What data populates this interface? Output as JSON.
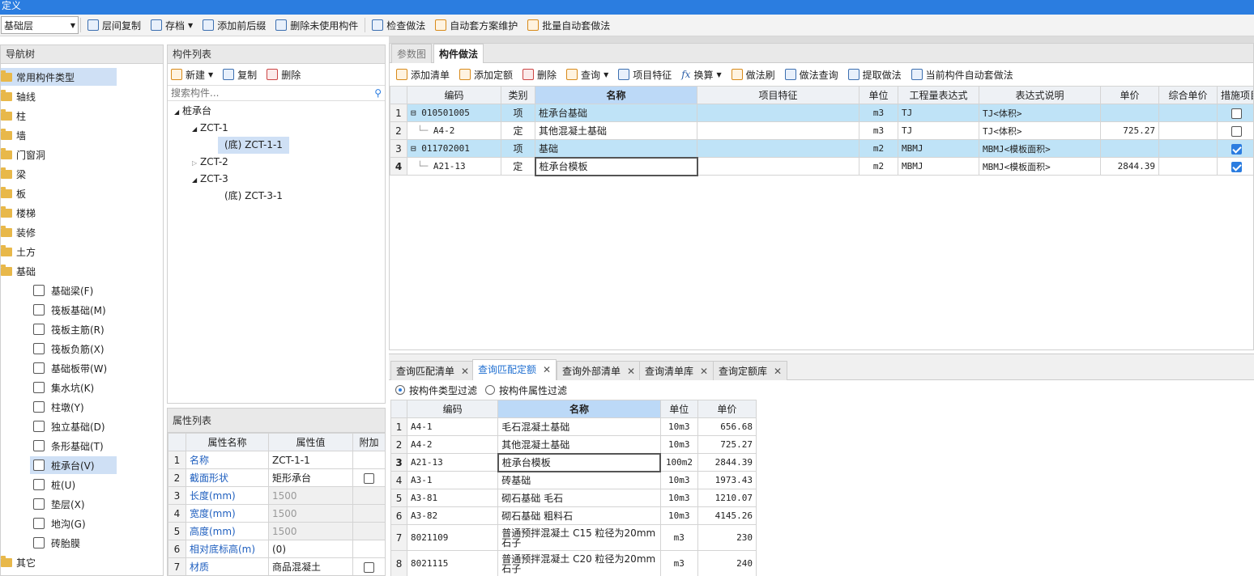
{
  "window": {
    "title": "定义"
  },
  "toolbar": {
    "layer": "基础层",
    "buttons": [
      "层间复制",
      "存档",
      "添加前后缀",
      "删除未使用构件",
      "检查做法",
      "自动套方案维护",
      "批量自动套做法"
    ]
  },
  "nav": {
    "title": "导航树",
    "items": [
      "常用构件类型",
      "轴线",
      "柱",
      "墙",
      "门窗洞",
      "梁",
      "板",
      "楼梯",
      "装修",
      "土方",
      "基础"
    ],
    "foundation_children": [
      "基础梁(F)",
      "筏板基础(M)",
      "筏板主筋(R)",
      "筏板负筋(X)",
      "基础板带(W)",
      "集水坑(K)",
      "柱墩(Y)",
      "独立基础(D)",
      "条形基础(T)",
      "桩承台(V)",
      "桩(U)",
      "垫层(X)",
      "地沟(G)",
      "砖胎膜"
    ],
    "other": "其它"
  },
  "component_list": {
    "title": "构件列表",
    "new_label": "新建",
    "copy_label": "复制",
    "delete_label": "删除",
    "search_placeholder": "搜索构件...",
    "tree": {
      "root": "桩承台",
      "n1": "ZCT-1",
      "n1a": "(底) ZCT-1-1",
      "n2": "ZCT-2",
      "n3": "ZCT-3",
      "n3a": "(底) ZCT-3-1"
    }
  },
  "properties": {
    "title": "属性列表",
    "headers": [
      "属性名称",
      "属性值",
      "附加"
    ],
    "rows": [
      {
        "no": "1",
        "name": "名称",
        "value": "ZCT-1-1"
      },
      {
        "no": "2",
        "name": "截面形状",
        "value": "矩形承台"
      },
      {
        "no": "3",
        "name": "长度(mm)",
        "value": "1500"
      },
      {
        "no": "4",
        "name": "宽度(mm)",
        "value": "1500"
      },
      {
        "no": "5",
        "name": "高度(mm)",
        "value": "1500"
      },
      {
        "no": "6",
        "name": "相对底标高(m)",
        "value": "(0)"
      },
      {
        "no": "7",
        "name": "材质",
        "value": "商品混凝土"
      }
    ]
  },
  "method": {
    "tabs": [
      "参数图",
      "构件做法"
    ],
    "toolbar": [
      "添加清单",
      "添加定额",
      "删除",
      "查询",
      "项目特征",
      "换算",
      "做法刷",
      "做法查询",
      "提取做法",
      "当前构件自动套做法"
    ],
    "headers": [
      "编码",
      "类别",
      "名称",
      "项目特征",
      "单位",
      "工程量表达式",
      "表达式说明",
      "单价",
      "综合单价",
      "措施项目"
    ],
    "rows": [
      {
        "no": "1",
        "code": "010501005",
        "type": "项",
        "name": "桩承台基础",
        "unit": "m3",
        "expr": "TJ",
        "desc": "TJ<体积>",
        "price": ""
      },
      {
        "no": "2",
        "code": "A4-2",
        "type": "定",
        "name": "其他混凝土基础",
        "unit": "m3",
        "expr": "TJ",
        "desc": "TJ<体积>",
        "price": "725.27"
      },
      {
        "no": "3",
        "code": "011702001",
        "type": "项",
        "name": "基础",
        "unit": "m2",
        "expr": "MBMJ",
        "desc": "MBMJ<模板面积>",
        "price": ""
      },
      {
        "no": "4",
        "code": "A21-13",
        "type": "定",
        "name": "桩承台模板",
        "unit": "m2",
        "expr": "MBMJ",
        "desc": "MBMJ<模板面积>",
        "price": "2844.39"
      }
    ]
  },
  "query": {
    "tabs": [
      "查询匹配清单",
      "查询匹配定额",
      "查询外部清单",
      "查询清单库",
      "查询定额库"
    ],
    "filter1": "按构件类型过滤",
    "filter2": "按构件属性过滤",
    "headers": [
      "编码",
      "名称",
      "单位",
      "单价"
    ],
    "rows": [
      {
        "no": "1",
        "code": "A4-1",
        "name": "毛石混凝土基础",
        "unit": "10m3",
        "price": "656.68"
      },
      {
        "no": "2",
        "code": "A4-2",
        "name": "其他混凝土基础",
        "unit": "10m3",
        "price": "725.27"
      },
      {
        "no": "3",
        "code": "A21-13",
        "name": "桩承台模板",
        "unit": "100m2",
        "price": "2844.39"
      },
      {
        "no": "4",
        "code": "A3-1",
        "name": "砖基础",
        "unit": "10m3",
        "price": "1973.43"
      },
      {
        "no": "5",
        "code": "A3-81",
        "name": "砌石基础 毛石",
        "unit": "10m3",
        "price": "1210.07"
      },
      {
        "no": "6",
        "code": "A3-82",
        "name": "砌石基础 粗料石",
        "unit": "10m3",
        "price": "4145.26"
      },
      {
        "no": "7",
        "code": "8021109",
        "name": "普通预拌混凝土 C15 粒径为20mm石子",
        "unit": "m3",
        "price": "230"
      },
      {
        "no": "8",
        "code": "8021115",
        "name": "普通预拌混凝土 C20 粒径为20mm石子",
        "unit": "m3",
        "price": "240"
      }
    ]
  }
}
